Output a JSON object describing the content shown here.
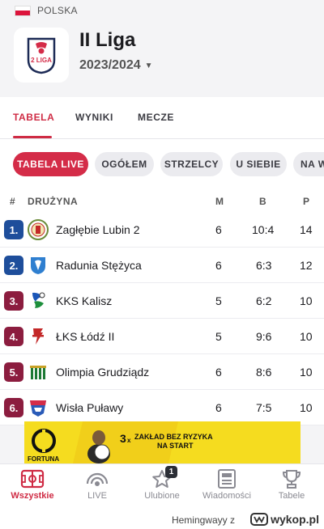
{
  "header": {
    "country": "POLSKA",
    "league_logo_text": "2 LIGA",
    "league_title": "II Liga",
    "season": "2023/2024"
  },
  "tabs": [
    {
      "label": "TABELA",
      "active": true
    },
    {
      "label": "WYNIKI",
      "active": false
    },
    {
      "label": "MECZE",
      "active": false
    }
  ],
  "filters": [
    {
      "label": "TABELA LIVE",
      "active": true
    },
    {
      "label": "OGÓŁEM",
      "active": false
    },
    {
      "label": "STRZELCY",
      "active": false
    },
    {
      "label": "U SIEBIE",
      "active": false
    },
    {
      "label": "NA W",
      "active": false
    }
  ],
  "table": {
    "headers": {
      "rank": "#",
      "team": "DRUŻYNA",
      "played": "M",
      "goals": "B",
      "points": "P"
    },
    "rows": [
      {
        "rank": "1.",
        "team": "Zagłębie Lubin 2",
        "played": "6",
        "goals": "10:4",
        "points": "14",
        "rank_color": "#1e4e9b"
      },
      {
        "rank": "2.",
        "team": "Radunia Stężyca",
        "played": "6",
        "goals": "6:3",
        "points": "12",
        "rank_color": "#1e4e9b"
      },
      {
        "rank": "3.",
        "team": "KKS Kalisz",
        "played": "5",
        "goals": "6:2",
        "points": "10",
        "rank_color": "#8c1d3f"
      },
      {
        "rank": "4.",
        "team": "ŁKS Łódź II",
        "played": "5",
        "goals": "9:6",
        "points": "10",
        "rank_color": "#8c1d3f"
      },
      {
        "rank": "5.",
        "team": "Olimpia Grudziądz",
        "played": "6",
        "goals": "8:6",
        "points": "10",
        "rank_color": "#8c1d3f"
      },
      {
        "rank": "6.",
        "team": "Wisła Puławy",
        "played": "6",
        "goals": "7:5",
        "points": "10",
        "rank_color": "#8c1d3f"
      }
    ]
  },
  "ad": {
    "brand": "FORTUNA",
    "multiplier": "3",
    "multiplier_x": "x",
    "line1": "ZAKŁAD BEZ RYZYKA",
    "line2": "NA START"
  },
  "bottom_nav": [
    {
      "label": "Wszystkie",
      "icon": "pitch-icon",
      "active": true
    },
    {
      "label": "LIVE",
      "icon": "live-icon",
      "active": false
    },
    {
      "label": "Ulubione",
      "icon": "star-icon",
      "active": false,
      "badge": "1"
    },
    {
      "label": "Wiadomości",
      "icon": "news-icon",
      "active": false
    },
    {
      "label": "Tabele",
      "icon": "trophy-icon",
      "active": false
    }
  ],
  "footer": {
    "username": "Hemingwayy",
    "z": "z",
    "site": "wykop.pl"
  },
  "colors": {
    "accent": "#cf2b44",
    "promotion": "#1e4e9b",
    "playoff": "#8c1d3f"
  }
}
